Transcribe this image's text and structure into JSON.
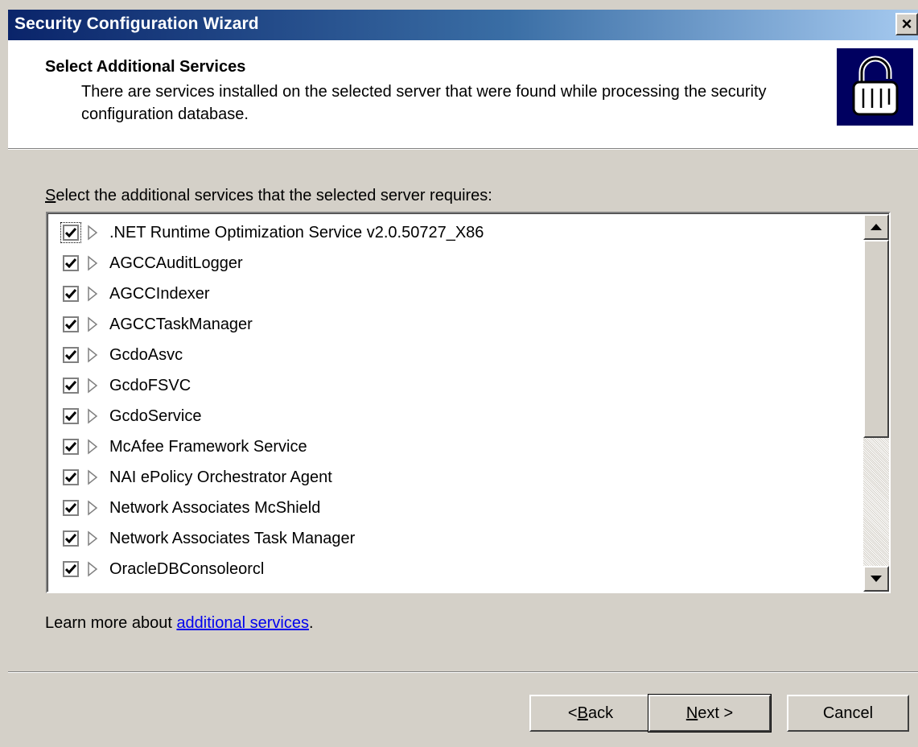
{
  "window": {
    "title": "Security Configuration Wizard",
    "close_label": "×"
  },
  "header": {
    "title": "Select Additional Services",
    "description": "There are services installed on the selected server that were found while processing the security configuration database.",
    "icon": "padlock-icon"
  },
  "instruction": {
    "mnemonic": "S",
    "rest": "elect the additional services that the selected server requires:"
  },
  "services": [
    {
      "label": ".NET Runtime Optimization Service v2.0.50727_X86",
      "checked": true
    },
    {
      "label": "AGCCAuditLogger",
      "checked": true
    },
    {
      "label": "AGCCIndexer",
      "checked": true
    },
    {
      "label": "AGCCTaskManager",
      "checked": true
    },
    {
      "label": "GcdoAsvc",
      "checked": true
    },
    {
      "label": "GcdoFSVC",
      "checked": true
    },
    {
      "label": "GcdoService",
      "checked": true
    },
    {
      "label": "McAfee Framework Service",
      "checked": true
    },
    {
      "label": "NAI ePolicy Orchestrator Agent",
      "checked": true
    },
    {
      "label": "Network Associates McShield",
      "checked": true
    },
    {
      "label": "Network Associates Task Manager",
      "checked": true
    },
    {
      "label": "OracleDBConsoleorcl",
      "checked": true
    }
  ],
  "learn_more": {
    "prefix": "Learn more about ",
    "link": "additional services",
    "suffix": "."
  },
  "buttons": {
    "back": {
      "pre": "< ",
      "mnemonic": "B",
      "rest": "ack"
    },
    "next": {
      "mnemonic": "N",
      "rest": "ext >"
    },
    "cancel": {
      "label": "Cancel"
    }
  },
  "colors": {
    "titlebar_start": "#0a246a",
    "titlebar_end": "#a6caf0",
    "dialog_bg": "#d4d0c8",
    "link": "#0000ee",
    "icon_bg": "#000060"
  }
}
